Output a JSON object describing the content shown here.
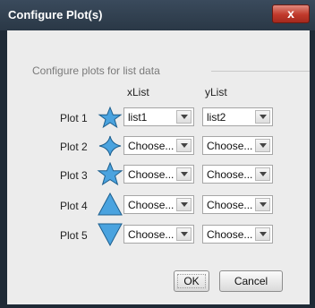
{
  "window": {
    "title": "Configure Plot(s)",
    "close_label": "x"
  },
  "group": {
    "label": "Configure plots for list data"
  },
  "columns": {
    "x_header": "xList",
    "y_header": "yList"
  },
  "plots": [
    {
      "label": "Plot 1",
      "marker": "star-icon",
      "x_value": "list1",
      "y_value": "list2"
    },
    {
      "label": "Plot 2",
      "marker": "diamond-icon",
      "x_value": "Choose...",
      "y_value": "Choose..."
    },
    {
      "label": "Plot 3",
      "marker": "star-icon",
      "x_value": "Choose...",
      "y_value": "Choose..."
    },
    {
      "label": "Plot 4",
      "marker": "triangle-up-icon",
      "x_value": "Choose...",
      "y_value": "Choose..."
    },
    {
      "label": "Plot 5",
      "marker": "triangle-down-icon",
      "x_value": "Choose...",
      "y_value": "Choose..."
    }
  ],
  "buttons": {
    "ok_label": "OK",
    "cancel_label": "Cancel"
  },
  "colors": {
    "marker_fill": "#4aa3df",
    "marker_stroke": "#1d5f8e"
  }
}
